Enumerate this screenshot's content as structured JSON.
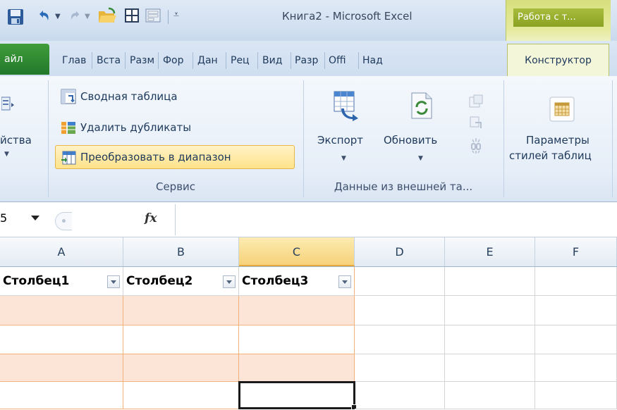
{
  "window": {
    "title": "Книга2 - Microsoft Excel",
    "context_group": "Работа с т..."
  },
  "tabs": {
    "file": "айл",
    "items": [
      "Глав",
      "Вста",
      "Разм",
      "Фор",
      "Дан",
      "Рец",
      "Вид",
      "Разр",
      "Offi",
      "Над"
    ],
    "active": "Конструктор"
  },
  "ribbon": {
    "properties": {
      "label": "йства"
    },
    "service": {
      "pivot": "Сводная таблица",
      "remove_duplicates": "Удалить дубликаты",
      "convert_range": "Преобразовать в диапазон",
      "group_label": "Сервис"
    },
    "external": {
      "export": "Экспорт",
      "refresh": "Обновить",
      "group_label": "Данные из внешней та..."
    },
    "styles": {
      "params_line1": "Параметры",
      "params_line2": "стилей таблиц"
    }
  },
  "formula_bar": {
    "namebox_tail": "5",
    "fx": "fx"
  },
  "grid": {
    "columns": [
      "A",
      "B",
      "C",
      "D",
      "E",
      "F"
    ],
    "selected_column": "C",
    "table_headers": [
      "Столбец1",
      "Столбец2",
      "Столбец3"
    ],
    "band_color": "#fce4d6",
    "border_color": "#f0b27a"
  },
  "colors": {
    "file_tab": "#2f8a33",
    "context_tab": "#9fb236",
    "ribbon_bg": "#e6eef8",
    "highlight": "#ffe28a"
  }
}
